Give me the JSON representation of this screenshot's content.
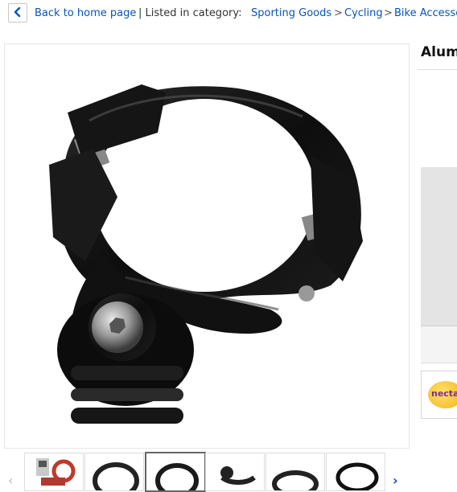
{
  "breadcrumb": {
    "back_label": "Back to home page",
    "listed_label": "| Listed in category:",
    "items": [
      "Sporting Goods",
      "Cycling",
      "Bike Accesso"
    ],
    "separator": ">"
  },
  "product": {
    "title_partial": "Alum"
  },
  "nectar": {
    "label": "nectar"
  },
  "gallery": {
    "selected_index": 2,
    "thumbnails": [
      "thumb-1",
      "thumb-2",
      "thumb-3",
      "thumb-4",
      "thumb-5",
      "thumb-6"
    ]
  },
  "colors": {
    "link": "#0654ba",
    "product": "#111111"
  }
}
